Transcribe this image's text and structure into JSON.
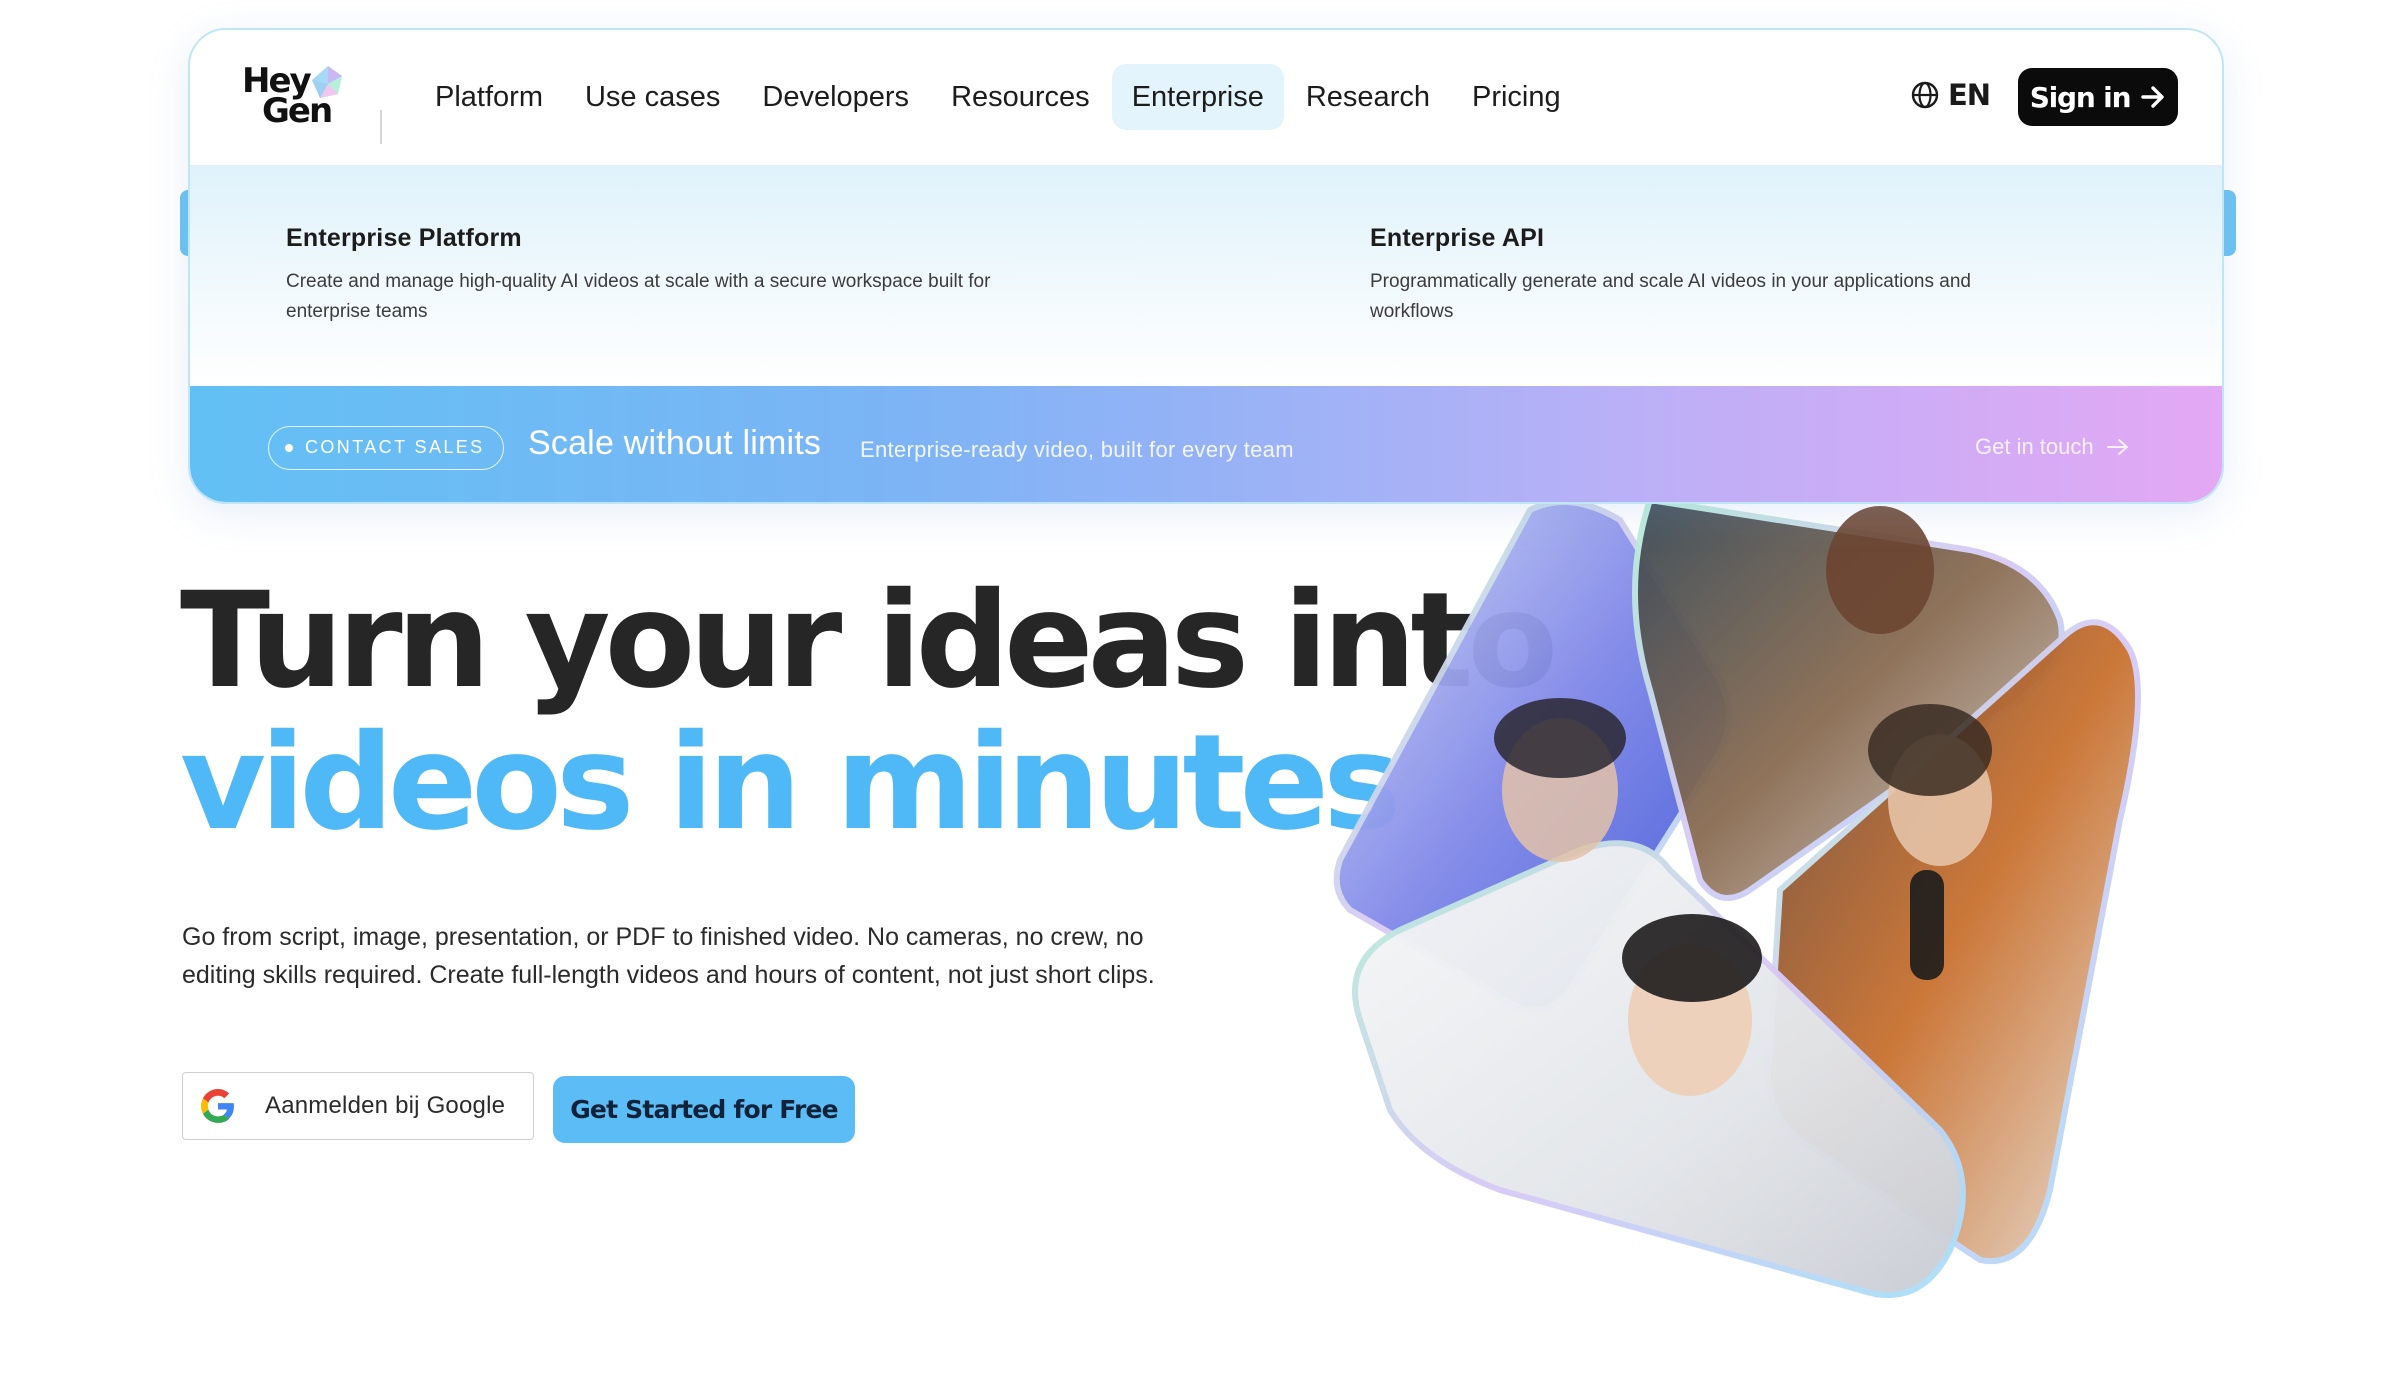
{
  "logo": {
    "line1": "Hey",
    "line2": "Gen"
  },
  "nav": {
    "links": [
      {
        "label": "Platform"
      },
      {
        "label": "Use cases"
      },
      {
        "label": "Developers"
      },
      {
        "label": "Resources"
      },
      {
        "label": "Enterprise",
        "active": true
      },
      {
        "label": "Research"
      },
      {
        "label": "Pricing"
      }
    ],
    "language": "EN",
    "signin_label": "Sign in"
  },
  "menu": {
    "items": [
      {
        "title": "Enterprise Platform",
        "description": "Create and manage high-quality AI videos at scale with a secure workspace built for enterprise teams"
      },
      {
        "title": "Enterprise API",
        "description": "Programmatically generate and scale AI videos in your applications and workflows"
      }
    ],
    "banner": {
      "pill": "CONTACT SALES",
      "title": "Scale without limits",
      "subtitle": "Enterprise-ready video, built for every team",
      "cta": "Get in touch"
    }
  },
  "hero": {
    "title_line1": "Turn your ideas into",
    "title_line2": "videos in minutes",
    "description": "Go from script, image, presentation, or PDF to finished video. No cameras, no crew, no editing skills required. Create full-length videos and hours of content, not just short clips.",
    "google_button": "Aanmelden bij Google",
    "cta_button": "Get Started for Free"
  },
  "colors": {
    "accent": "#4fb9f7",
    "cta_bg": "#5cbcf6",
    "signin_bg": "#0b0b0b",
    "active_tab_bg": "#e3f4fc"
  },
  "icons": {
    "logo_mark": "gem-icon",
    "globe": "globe-icon",
    "signin_arrow": "arrow-right-icon",
    "google": "google-icon",
    "banner_arrow": "arrow-right-icon"
  }
}
